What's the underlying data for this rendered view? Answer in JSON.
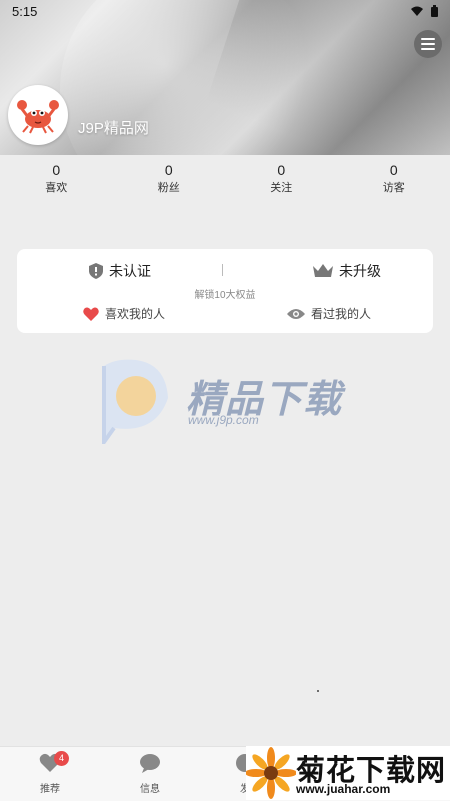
{
  "status_bar": {
    "time": "5:15"
  },
  "profile": {
    "username": "J9P精品网"
  },
  "stats": [
    {
      "value": "0",
      "label": "喜欢"
    },
    {
      "value": "0",
      "label": "粉丝"
    },
    {
      "value": "0",
      "label": "关注"
    },
    {
      "value": "0",
      "label": "访客"
    }
  ],
  "card": {
    "certification": "未认证",
    "upgrade": "未升级",
    "unlock_text": "解锁10大权益",
    "likes_me": "喜欢我的人",
    "viewed_me": "看过我的人"
  },
  "watermark": {
    "text": "精品下载",
    "url": "www.j9p.com"
  },
  "bottom_nav": {
    "items": [
      {
        "label": "推荐",
        "badge": "4",
        "icon": "heart-icon"
      },
      {
        "label": "信息",
        "icon": "chat-icon"
      },
      {
        "label": "发",
        "icon": "compass-icon"
      }
    ]
  },
  "footer_watermark": {
    "title": "菊花下载网",
    "url": "www.juahar.com"
  },
  "colors": {
    "like_red": "#e84a4a",
    "badge_red": "#e84a4a",
    "watermark_blue": "#9aa8c0"
  }
}
